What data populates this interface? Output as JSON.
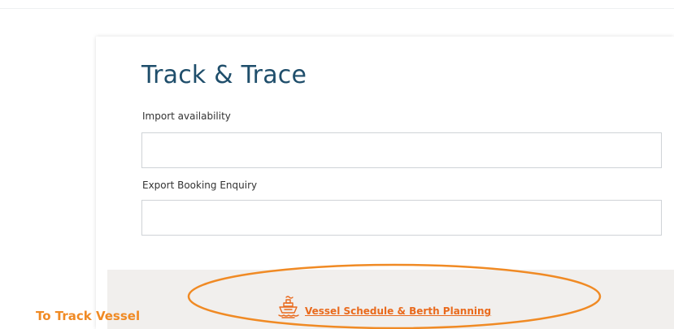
{
  "card": {
    "title": "Track & Trace"
  },
  "fields": {
    "import": {
      "label": "Import availability",
      "value": "",
      "placeholder": ""
    },
    "export": {
      "label": "Export Booking Enquiry",
      "value": "",
      "placeholder": ""
    }
  },
  "footer": {
    "vessel_link_label": "Vessel Schedule & Berth Planning",
    "vessel_icon": "ship-icon"
  },
  "annotation": {
    "label": "To Track Vessel"
  },
  "colors": {
    "title": "#1f4e6b",
    "link": "#e96a1d",
    "annotation": "#f08a24",
    "footer_bg": "#f1efed",
    "input_border": "#cfd3d7"
  }
}
